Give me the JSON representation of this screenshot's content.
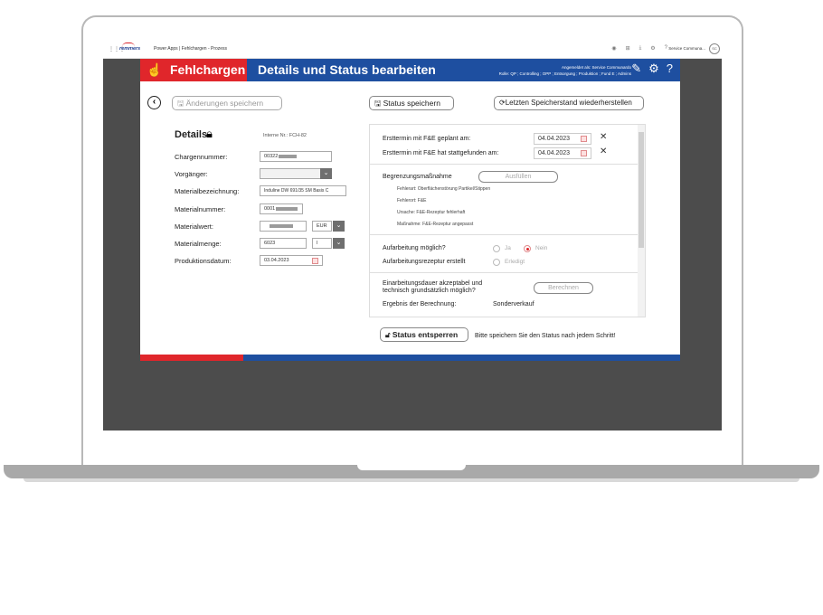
{
  "topbar": {
    "waffle": "⋮⋮⋮",
    "brand": "remmers",
    "app_title": "Power Apps | Fehlchargen - Prozess",
    "user": "Service Communa...",
    "avatar": "SC"
  },
  "header": {
    "app_name": "Fehlchargen",
    "page_title": "Details und Status bearbeiten",
    "login_line1": "Angemeldet als: Service Communardo",
    "login_line2": "Rolle: QP ; Controlling ; OPP ; Entsorgung ; Produktion ; Fund E ; Admins",
    "accent_red": "#e0262b",
    "accent_blue": "#1e4fa0"
  },
  "toolbar": {
    "save_changes": "Änderungen speichern",
    "save_status": "Status speichern",
    "restore": "Letzten Speicherstand wiederherstellen"
  },
  "details": {
    "heading": "Details",
    "internal_nr": "Interne Nr.: FCH-82",
    "fields": [
      {
        "label": "Chargennummer:",
        "value": "00322"
      },
      {
        "label": "Vorgänger:",
        "value": ""
      },
      {
        "label": "Materialbezeichnung:",
        "value": "Induline DW 691/35 SM Basis C"
      },
      {
        "label": "Materialnummer:",
        "value": "0001"
      },
      {
        "label": "Materialwert:",
        "value": "",
        "currency": "EUR"
      },
      {
        "label": "Materialmenge:",
        "value": "6023",
        "unit": "l"
      },
      {
        "label": "Produktionsdatum:",
        "value": "03.04.2023"
      }
    ]
  },
  "status": {
    "erst_geplant_label": "Ersttermin mit F&E geplant am:",
    "erst_geplant_date": "04.04.2023",
    "erst_stattgefunden_label": "Ersttermin mit F&E hat stattgefunden am:",
    "erst_stattgefunden_date": "04.04.2023",
    "begrenzung_label": "Begrenzungsmaßnahme",
    "ausfuellen": "Ausfüllen",
    "fehlerart": "Fehlerart: Oberflächenstörung Partikel/Stippen",
    "fehlerort": "Fehlerort: F&E",
    "ursache": "Ursache: F&E-Rezeptur fehlerhaft",
    "massnahme": "Maßnahme: F&E-Rezeptur angepasst",
    "aufarbeitung_label": "Aufarbeitung möglich?",
    "ja": "Ja",
    "nein": "Nein",
    "rezeptur_label": "Aufarbeitungsrezeptur erstellt",
    "erledigt": "Erledigt",
    "dauer_label_1": "Einarbeitungsdauer akzeptabel und",
    "dauer_label_2": "technisch grundsätzlich möglich?",
    "berechnen": "Berechnen",
    "ergebnis_label": "Ergebnis der Berechnung:",
    "ergebnis_value": "Sonderverkauf"
  },
  "footer": {
    "unlock": "Status entsperren",
    "hint": "Bitte speichern Sie den Status nach jedem Schritt!"
  }
}
